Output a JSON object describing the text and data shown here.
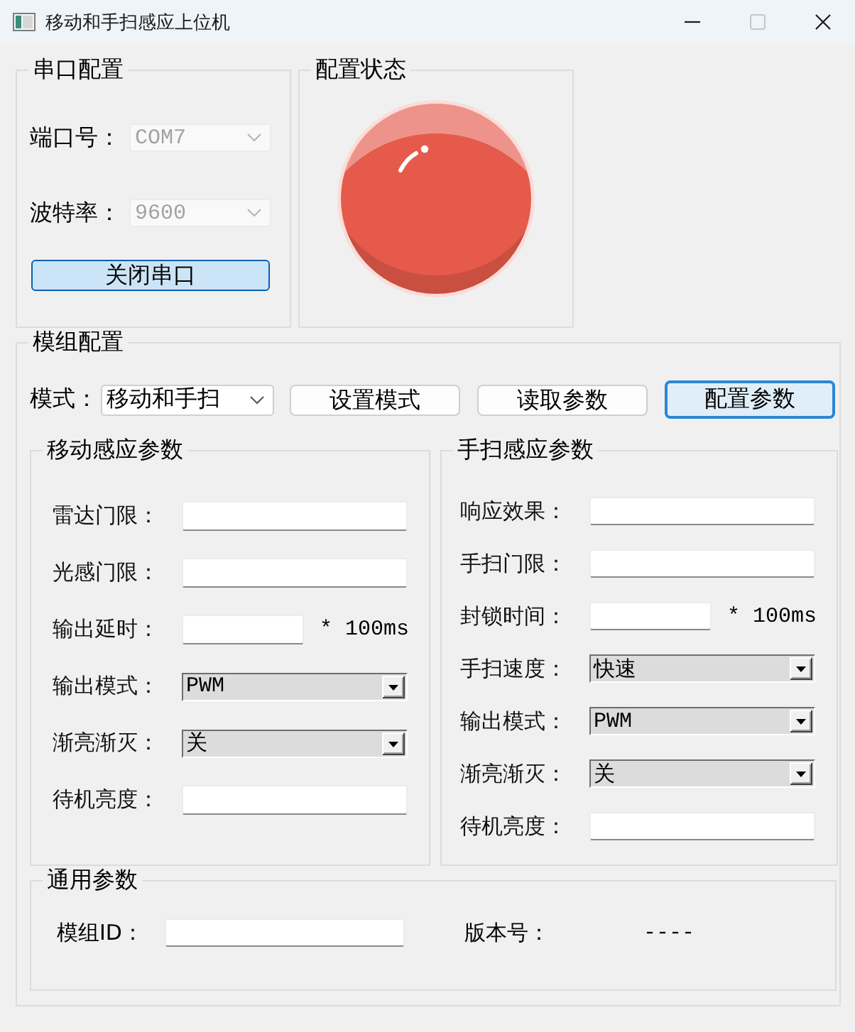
{
  "window": {
    "title": "移动和手扫感应上位机",
    "controls": [
      {
        "kind": "minimize",
        "disabled": false
      },
      {
        "kind": "maximize",
        "disabled": true
      },
      {
        "kind": "close",
        "disabled": false
      }
    ]
  },
  "serial_config": {
    "title": "串口配置",
    "fields": [
      {
        "label": "端口号：",
        "value": "COM7",
        "disabled": true
      },
      {
        "label": "波特率：",
        "value": "9600",
        "disabled": true
      }
    ],
    "button": {
      "label": "关闭串口",
      "checked": true
    }
  },
  "config_status": {
    "title": "配置状态",
    "light": {
      "color": "#e55a4b"
    }
  },
  "module_config": {
    "title": "模组配置",
    "mode_label": "模式：",
    "mode": {
      "value": "移动和手扫"
    },
    "buttons": [
      {
        "label": "设置模式",
        "focused": false
      },
      {
        "label": "读取参数",
        "focused": false
      },
      {
        "label": "配置参数",
        "focused": true
      }
    ],
    "motion_params": {
      "title": "移动感应参数",
      "rows": [
        {
          "kind": "input",
          "label": "雷达门限："
        },
        {
          "kind": "input",
          "label": "光感门限："
        },
        {
          "kind": "input",
          "label": "输出延时：",
          "suffix": "* 100ms"
        },
        {
          "kind": "combo",
          "label": "输出模式：",
          "value": "PWM"
        },
        {
          "kind": "combo",
          "label": "渐亮渐灭：",
          "value": "关"
        },
        {
          "kind": "input",
          "label": "待机亮度："
        }
      ]
    },
    "sweep_params": {
      "title": "手扫感应参数",
      "rows": [
        {
          "kind": "input",
          "label": "响应效果："
        },
        {
          "kind": "input",
          "label": "手扫门限："
        },
        {
          "kind": "input",
          "label": "封锁时间：",
          "suffix": "* 100ms"
        },
        {
          "kind": "combo",
          "label": "手扫速度：",
          "value": "快速"
        },
        {
          "kind": "combo",
          "label": "输出模式：",
          "value": "PWM"
        },
        {
          "kind": "combo",
          "label": "渐亮渐灭：",
          "value": "关"
        },
        {
          "kind": "input",
          "label": "待机亮度："
        }
      ]
    },
    "general_params": {
      "title": "通用参数",
      "module_id": {
        "label": "模组ID："
      },
      "version": {
        "label": "版本号：",
        "value": "----"
      }
    }
  }
}
